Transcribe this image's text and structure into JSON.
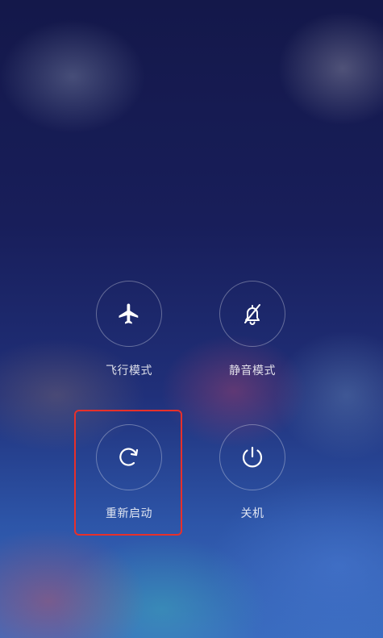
{
  "power_menu": {
    "airplane_mode": {
      "label": "飞行模式",
      "icon": "airplane-icon"
    },
    "silent_mode": {
      "label": "静音模式",
      "icon": "bell-off-icon"
    },
    "restart": {
      "label": "重新启动",
      "icon": "restart-icon"
    },
    "power_off": {
      "label": "关机",
      "icon": "power-icon"
    }
  },
  "highlight": {
    "target": "restart",
    "color": "#e8302a"
  }
}
